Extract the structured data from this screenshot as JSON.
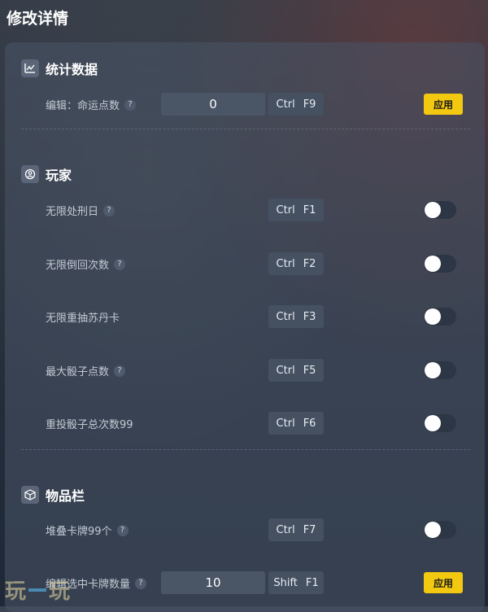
{
  "page": {
    "title": "修改详情"
  },
  "sections": {
    "stats": {
      "title": "统计数据",
      "icon": "chart-icon",
      "rows": [
        {
          "label": "编辑：命运点数",
          "value": "0",
          "hotkey_mod": "Ctrl",
          "hotkey_key": "F9",
          "apply": "应用"
        }
      ]
    },
    "player": {
      "title": "玩家",
      "icon": "player-icon",
      "rows": [
        {
          "label": "无限处刑日",
          "hotkey_mod": "Ctrl",
          "hotkey_key": "F1",
          "enabled": false
        },
        {
          "label": "无限倒回次数",
          "hotkey_mod": "Ctrl",
          "hotkey_key": "F2",
          "enabled": false
        },
        {
          "label": "无限重抽苏丹卡",
          "hotkey_mod": "Ctrl",
          "hotkey_key": "F3",
          "enabled": false
        },
        {
          "label": "最大骰子点数",
          "hotkey_mod": "Ctrl",
          "hotkey_key": "F5",
          "enabled": false
        },
        {
          "label": "重投骰子总次数99",
          "hotkey_mod": "Ctrl",
          "hotkey_key": "F6",
          "enabled": false
        }
      ]
    },
    "inventory": {
      "title": "物品栏",
      "icon": "box-icon",
      "rows": [
        {
          "label": "堆叠卡牌99个",
          "hotkey_mod": "Ctrl",
          "hotkey_key": "F7",
          "enabled": false
        },
        {
          "label": "编辑选中卡牌数量",
          "value": "10",
          "hotkey_mod": "Shift",
          "hotkey_key": "F1",
          "apply": "应用"
        }
      ]
    }
  },
  "help_glyph": "?",
  "watermark": {
    "left": "玩",
    "right": "玩"
  },
  "colors": {
    "accent": "#f2c811",
    "panel": "#48566a",
    "toggle_off": "#2d3644"
  }
}
